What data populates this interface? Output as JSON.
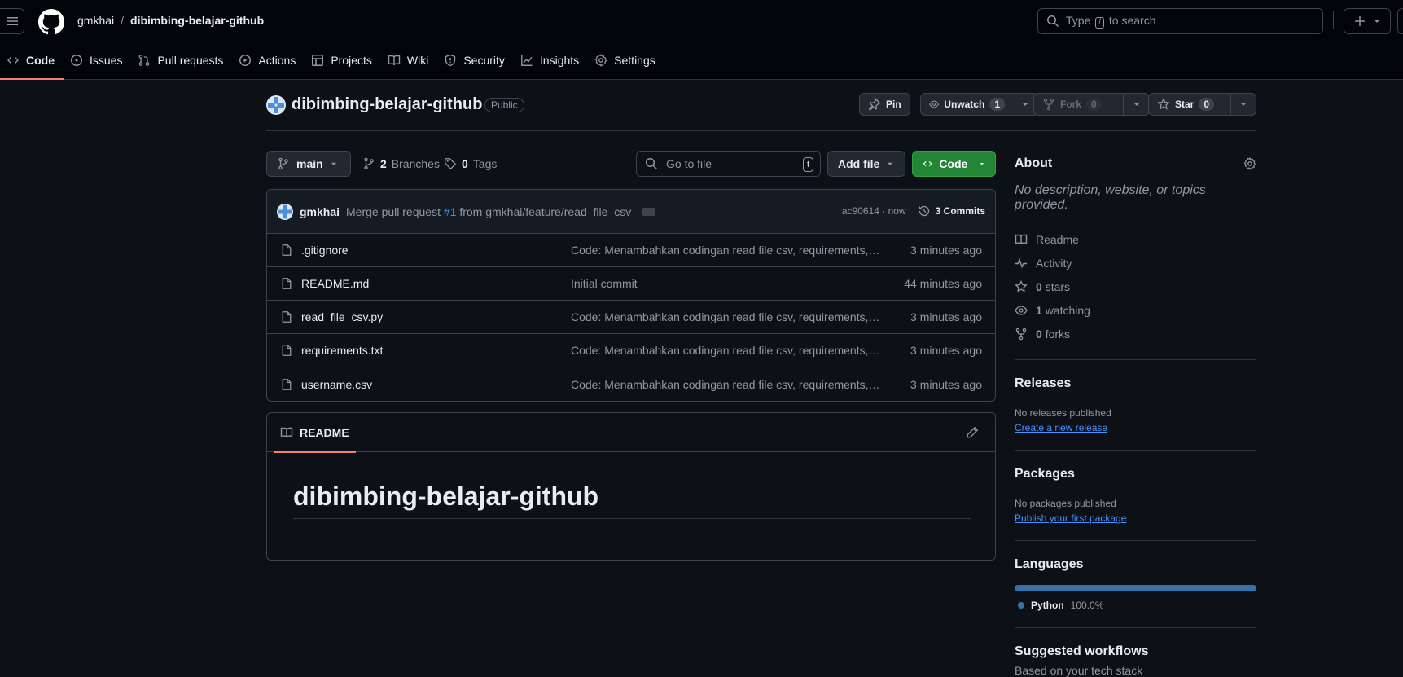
{
  "header": {
    "owner": "gmkhai",
    "separator": "/",
    "repo": "dibimbing-belajar-github",
    "search_prefix": "Type",
    "search_key": "/",
    "search_suffix": "to search"
  },
  "nav": {
    "tabs": [
      {
        "label": "Code",
        "icon": "code-icon",
        "active": true
      },
      {
        "label": "Issues",
        "icon": "issue-icon"
      },
      {
        "label": "Pull requests",
        "icon": "pull-request-icon"
      },
      {
        "label": "Actions",
        "icon": "play-icon"
      },
      {
        "label": "Projects",
        "icon": "table-icon"
      },
      {
        "label": "Wiki",
        "icon": "book-icon"
      },
      {
        "label": "Security",
        "icon": "shield-icon"
      },
      {
        "label": "Insights",
        "icon": "graph-icon"
      },
      {
        "label": "Settings",
        "icon": "gear-icon"
      }
    ]
  },
  "repo": {
    "title": "dibimbing-belajar-github",
    "visibility": "Public",
    "pin_label": "Pin",
    "unwatch_label": "Unwatch",
    "watch_count": "1",
    "fork_label": "Fork",
    "fork_count": "0",
    "star_label": "Star",
    "star_count": "0"
  },
  "toolbar": {
    "branch": "main",
    "branches_count": "2",
    "branches_label": "Branches",
    "tags_count": "0",
    "tags_label": "Tags",
    "go_to_file_placeholder": "Go to file",
    "go_to_file_key": "t",
    "add_file_label": "Add file",
    "code_label": "Code"
  },
  "commit": {
    "author": "gmkhai",
    "message_prefix": "Merge pull request",
    "pr_link": "#1",
    "message_suffix": "from gmkhai/feature/read_file_csv",
    "hash_time": "ac90614 · now",
    "commits_label": "3 Commits"
  },
  "files": [
    {
      "name": ".gitignore",
      "message": "Code: Menambahkan codingan read file csv, requirements, u...",
      "time": "3 minutes ago"
    },
    {
      "name": "README.md",
      "message": "Initial commit",
      "time": "44 minutes ago"
    },
    {
      "name": "read_file_csv.py",
      "message": "Code: Menambahkan codingan read file csv, requirements, u...",
      "time": "3 minutes ago"
    },
    {
      "name": "requirements.txt",
      "message": "Code: Menambahkan codingan read file csv, requirements, u...",
      "time": "3 minutes ago"
    },
    {
      "name": "username.csv",
      "message": "Code: Menambahkan codingan read file csv, requirements, u...",
      "time": "3 minutes ago"
    }
  ],
  "readme": {
    "tab_label": "README",
    "heading": "dibimbing-belajar-github"
  },
  "about": {
    "title": "About",
    "description": "No description, website, or topics provided.",
    "items": [
      {
        "icon": "book-icon",
        "count": "",
        "label": "Readme"
      },
      {
        "icon": "pulse-icon",
        "count": "",
        "label": "Activity"
      },
      {
        "icon": "star-icon",
        "count": "0",
        "label": "stars"
      },
      {
        "icon": "eye-icon",
        "count": "1",
        "label": "watching"
      },
      {
        "icon": "fork-icon",
        "count": "0",
        "label": "forks"
      }
    ]
  },
  "releases": {
    "title": "Releases",
    "empty": "No releases published",
    "link": "Create a new release"
  },
  "packages": {
    "title": "Packages",
    "empty": "No packages published",
    "link": "Publish your first package"
  },
  "languages": {
    "title": "Languages",
    "name": "Python",
    "percent": "100.0%",
    "share": 1.0,
    "color": "#3572a5"
  },
  "workflows": {
    "title": "Suggested workflows",
    "subtitle": "Based on your tech stack"
  }
}
